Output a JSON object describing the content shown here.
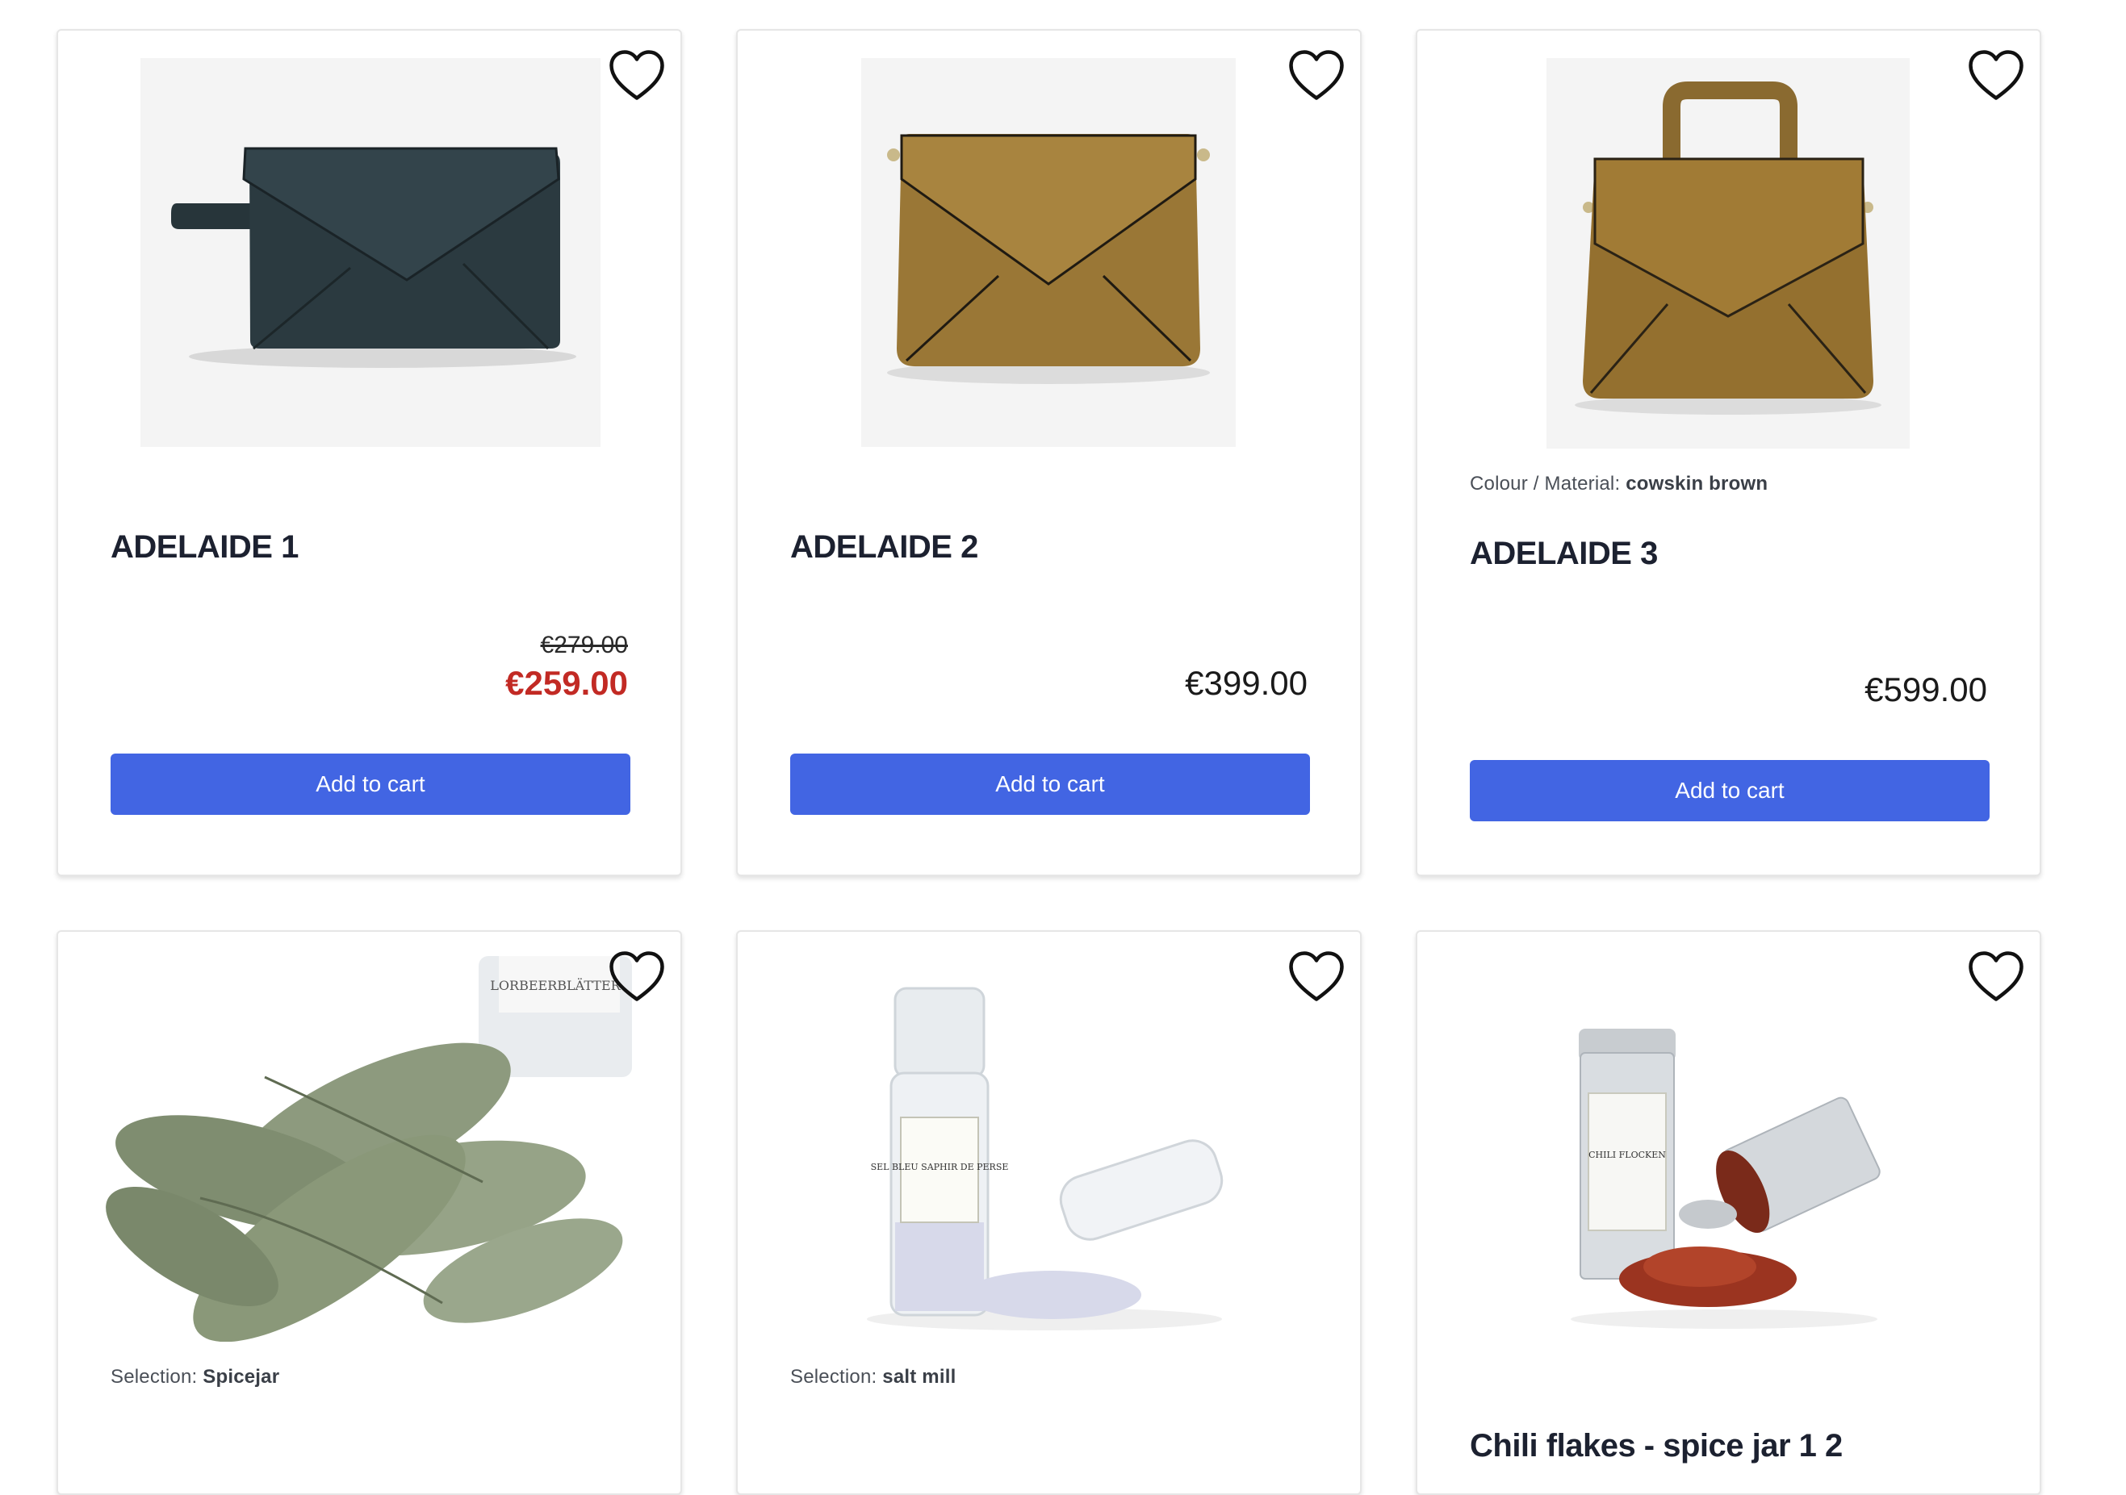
{
  "colors": {
    "accent": "#4265e3",
    "sale": "#c22a24",
    "card_border": "#e6e6e6"
  },
  "products": [
    {
      "title": "ADELAIDE 1",
      "old_price": "€279.00",
      "price": "€259.00",
      "button": "Add to cart",
      "wishlist_icon": "heart-outline-icon",
      "image": "dark-green-leather-clutch"
    },
    {
      "title": "ADELAIDE 2",
      "price": "€399.00",
      "button": "Add to cart",
      "wishlist_icon": "heart-outline-icon",
      "image": "brown-leather-crossbody-bag"
    },
    {
      "variant_label": "Colour / Material:",
      "variant_value": "cowskin brown",
      "title": "ADELAIDE 3",
      "price": "€599.00",
      "button": "Add to cart",
      "wishlist_icon": "heart-outline-icon",
      "image": "brown-leather-handbag"
    },
    {
      "variant_label": "Selection:",
      "variant_value": "Spicejar",
      "wishlist_icon": "heart-outline-icon",
      "image": "bay-leaves-spice-jar",
      "image_text": "LORBEERBLÄTTER"
    },
    {
      "variant_label": "Selection:",
      "variant_value": "salt mill",
      "wishlist_icon": "heart-outline-icon",
      "image": "blue-salt-mill",
      "image_text": "SEL BLEU SAPHIR DE PERSE"
    },
    {
      "title": "Chili flakes - spice jar 1 2",
      "wishlist_icon": "heart-outline-icon",
      "image": "chili-flakes-tin",
      "image_text": "CHILI FLOCKEN"
    }
  ]
}
